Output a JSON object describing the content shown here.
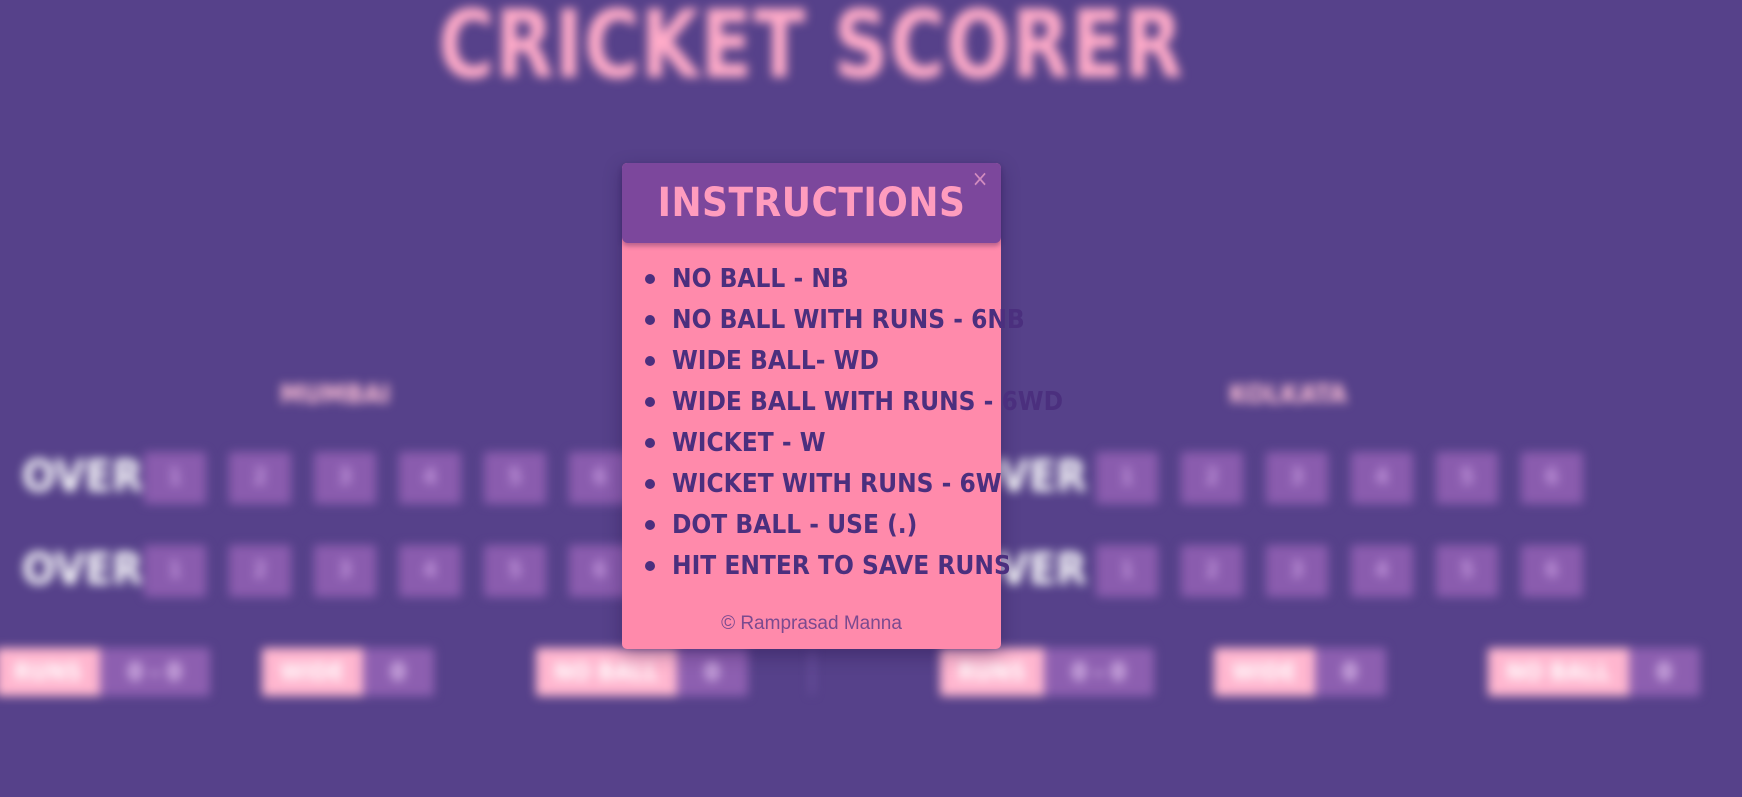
{
  "app": {
    "title": "CRICKET SCORER"
  },
  "teams": [
    {
      "name": "MUMBAI",
      "overs": [
        {
          "label": "OVER 1",
          "balls": [
            "1",
            "2",
            "3",
            "4",
            "5",
            "6"
          ]
        },
        {
          "label": "OVER 2",
          "balls": [
            "1",
            "2",
            "3",
            "4",
            "5",
            "6"
          ]
        }
      ],
      "stats": [
        {
          "label": "RUNS",
          "value": "0 - 0"
        },
        {
          "label": "WIDE",
          "value": "0"
        },
        {
          "label": "NO BALL",
          "value": "0"
        }
      ]
    },
    {
      "name": "KOLKATA",
      "overs": [
        {
          "label": "OVER 1",
          "balls": [
            "1",
            "2",
            "3",
            "4",
            "5",
            "6"
          ]
        },
        {
          "label": "OVER 2",
          "balls": [
            "1",
            "2",
            "3",
            "4",
            "5",
            "6"
          ]
        }
      ],
      "stats": [
        {
          "label": "RUNS",
          "value": "0 - 0"
        },
        {
          "label": "WIDE",
          "value": "0"
        },
        {
          "label": "NO BALL",
          "value": "0"
        }
      ]
    }
  ],
  "modal": {
    "title": "INSTRUCTIONS",
    "close_glyph": "×",
    "instructions": [
      "NO BALL - NB",
      "NO BALL WITH RUNS - 6NB",
      "WIDE BALL- WD",
      "WIDE BALL WITH RUNS - 6WD",
      "WICKET - W",
      "WICKET WITH RUNS - 6W",
      "DOT BALL - USE (.)",
      "HIT ENTER TO SAVE RUNS"
    ],
    "copyright": "© Ramprasad Manna"
  },
  "colors": {
    "background": "#56418a",
    "modal_body": "#ff8aab",
    "modal_header": "#7c479c",
    "accent_pink": "#ffabc8",
    "text_dark_purple": "#4b2f7e"
  },
  "icons": {
    "close": "close-icon",
    "bullet": "bullet-dot-icon"
  }
}
